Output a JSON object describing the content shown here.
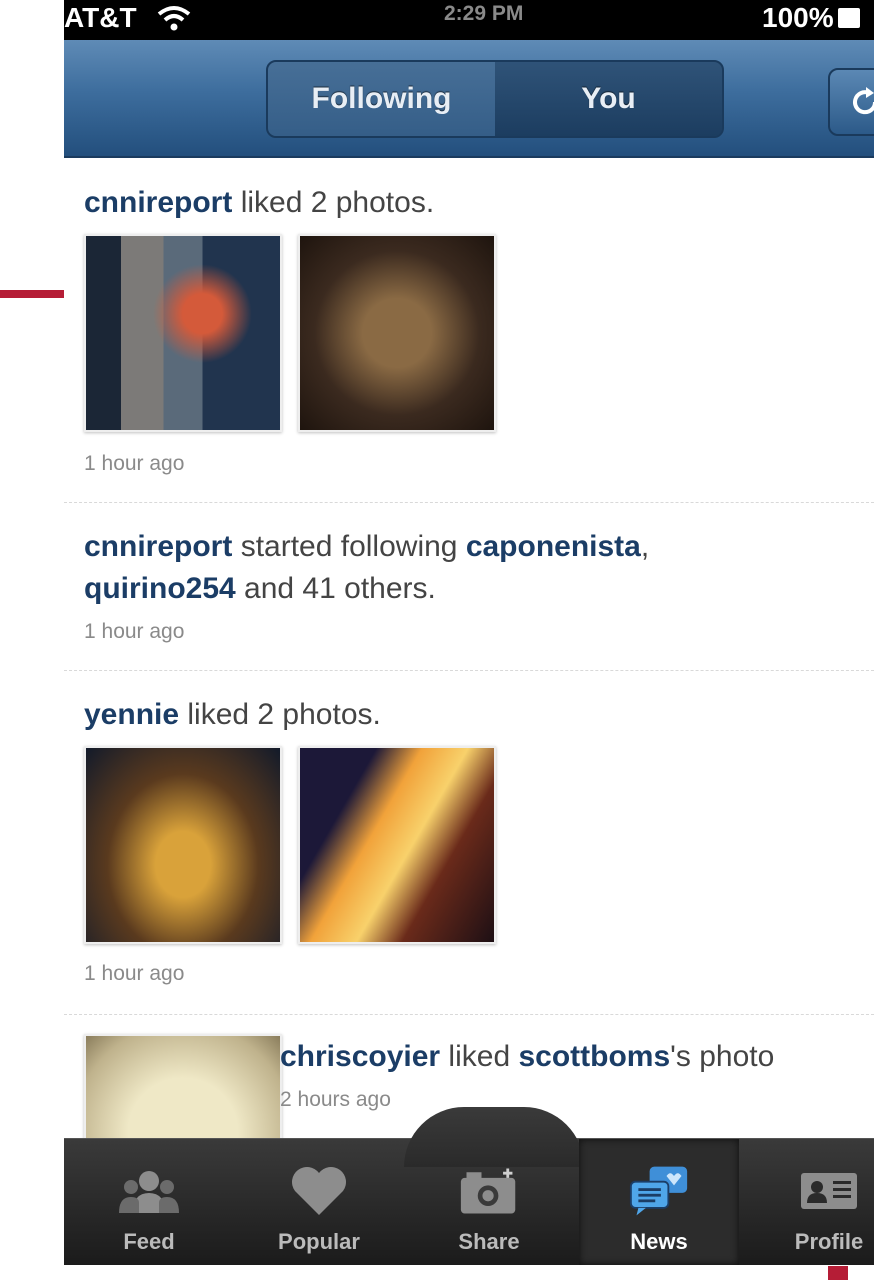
{
  "status_bar": {
    "carrier": "AT&T",
    "time": "2:29 PM",
    "battery": "100%"
  },
  "navbar": {
    "tabs": [
      {
        "label": "Following",
        "active": true
      },
      {
        "label": "You",
        "active": false
      }
    ],
    "refresh_icon": "refresh-icon"
  },
  "feed": [
    {
      "user": "cnnireport",
      "action": " liked 2 photos.",
      "time": "1 hour ago",
      "thumbnails": 2
    },
    {
      "user": "cnnireport",
      "action_part1": " started following ",
      "target1": "caponenista",
      "sep": ",",
      "target2": "quirino254",
      "action_part2": " and 41 others.",
      "time": "1 hour ago"
    },
    {
      "user": "yennie",
      "action": " liked 2 photos.",
      "time": "1 hour ago",
      "thumbnails": 2
    },
    {
      "user": "chriscoyier",
      "action": " liked ",
      "target": "scottboms",
      "suffix": "'s photo",
      "time": "2 hours ago"
    }
  ],
  "tabbar": [
    {
      "label": "Feed",
      "icon": "people-icon"
    },
    {
      "label": "Popular",
      "icon": "heart-icon"
    },
    {
      "label": "Share",
      "icon": "camera-icon"
    },
    {
      "label": "News",
      "icon": "speech-bubbles-icon",
      "active": true
    },
    {
      "label": "Profile",
      "icon": "id-card-icon"
    }
  ],
  "colors": {
    "accent_link": "#1b3d66",
    "navbar": "#3d6d9d",
    "callout": "#b51d36"
  }
}
